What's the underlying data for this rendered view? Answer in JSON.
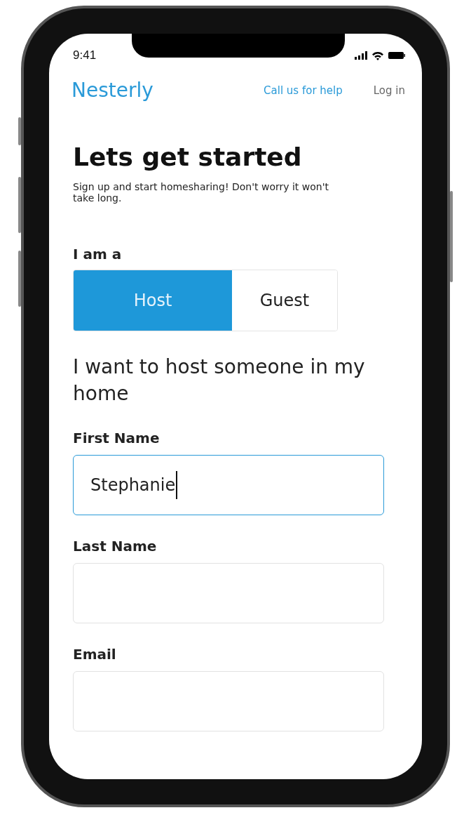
{
  "status_bar": {
    "time": "9:41"
  },
  "nav": {
    "logo": "Nesterly",
    "links": [
      "Call us for help",
      "Log in"
    ]
  },
  "title": "Lets get started",
  "subtitle": "Sign up and start homesharing! Don't worry it won't take long.",
  "role": {
    "label": "I am a",
    "options": [
      {
        "label": "Host",
        "selected": true
      },
      {
        "label": "Guest",
        "selected": false
      }
    ]
  },
  "role_description": "I want to host someone in my home",
  "fields": [
    {
      "label": "First Name",
      "value": "Stephanie",
      "focused": true
    },
    {
      "label": "Last Name",
      "focused": false
    },
    {
      "label": "Email",
      "focused": false
    }
  ]
}
